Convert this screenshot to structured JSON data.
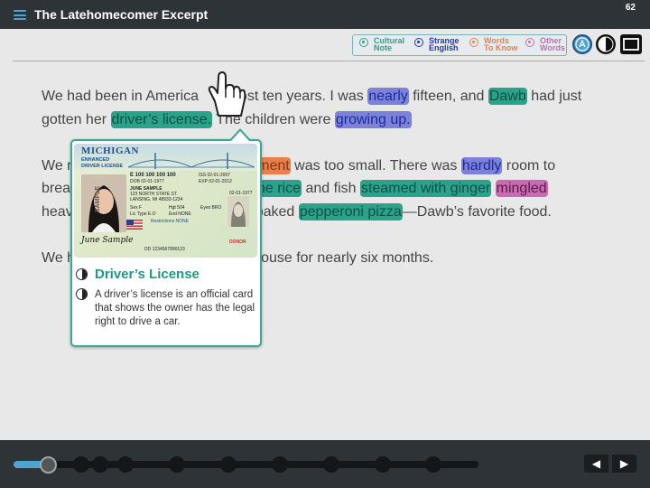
{
  "header": {
    "title": "The Latehomecomer Excerpt",
    "page_number": "62"
  },
  "legend": {
    "items": [
      {
        "line1": "Cultural",
        "line2": "Note",
        "color": "#2aa38a"
      },
      {
        "line1": "Strange",
        "line2": "English",
        "color": "#2b34a8"
      },
      {
        "line1": "Words",
        "line2": "To Know",
        "color": "#e8804b"
      },
      {
        "line1": "Other",
        "line2": "Words",
        "color": "#c96bb1"
      }
    ]
  },
  "toolbar": {
    "icons": [
      "accessibility-icon",
      "audio-icon",
      "screen-icon"
    ]
  },
  "passage": {
    "p1": {
      "s1": "We had been in America",
      "s1b": "lmost ten years. I was",
      "w_nearly": "nearly",
      "s2": " fifteen, and ",
      "w_dawb": "Dawb",
      "s3": " had just gotten her ",
      "w_license": "driver’s license.",
      "s4": " The children were ",
      "w_growing": "growing up."
    },
    "p2": {
      "s1": "We r",
      "w_apartment": "artment",
      "s2": " was too small. There was ",
      "w_hardly": "hardly",
      "s3": " room to",
      "s4": "brea",
      "w_rice": "he rice",
      "s5": " and fish ",
      "w_steamed": "steamed with ginger",
      "s6": " ",
      "w_mingled": "mingled",
      "s7": "heav",
      "s8": "baked ",
      "w_pizza": "pepperoni pizza",
      "s9": "—Dawb’s favorite food."
    },
    "p3": {
      "s1": "We h",
      "s2": "ouse for nearly six months."
    }
  },
  "popup": {
    "title": "Driver’s License",
    "definition": "A driver’s license is an official card that shows the owner has the legal right to drive a car.",
    "license": {
      "state": "MICHIGAN",
      "line1": "ENHANCED",
      "line2": "DRIVER LICENSE",
      "number": "E 100 100 100 100",
      "iss": "ISS 02-01-2007",
      "dob": "DOB 02-01-1977",
      "exp": "EXP 02-01-2012",
      "name": "JUNE SAMPLE",
      "addr1": "123 NORTH STATE ST.",
      "addr2": "LANSING, MI 48933-1234",
      "sex": "Sex F",
      "hgt": "Hgt 504",
      "eyes": "Eyes BRO",
      "lic_type": "Lic Type E.O",
      "end": "End NONE",
      "restrictions": "Restrictions NONE",
      "dd": "DD 1234567890123",
      "sample": "SAMPLE",
      "signature": "June Sample",
      "donor": "DONOR",
      "small_date": "02-01-1977"
    }
  },
  "progress": {
    "value": 0.05,
    "stops": 9
  },
  "nav": {
    "prev": "◀",
    "next": "▶"
  }
}
